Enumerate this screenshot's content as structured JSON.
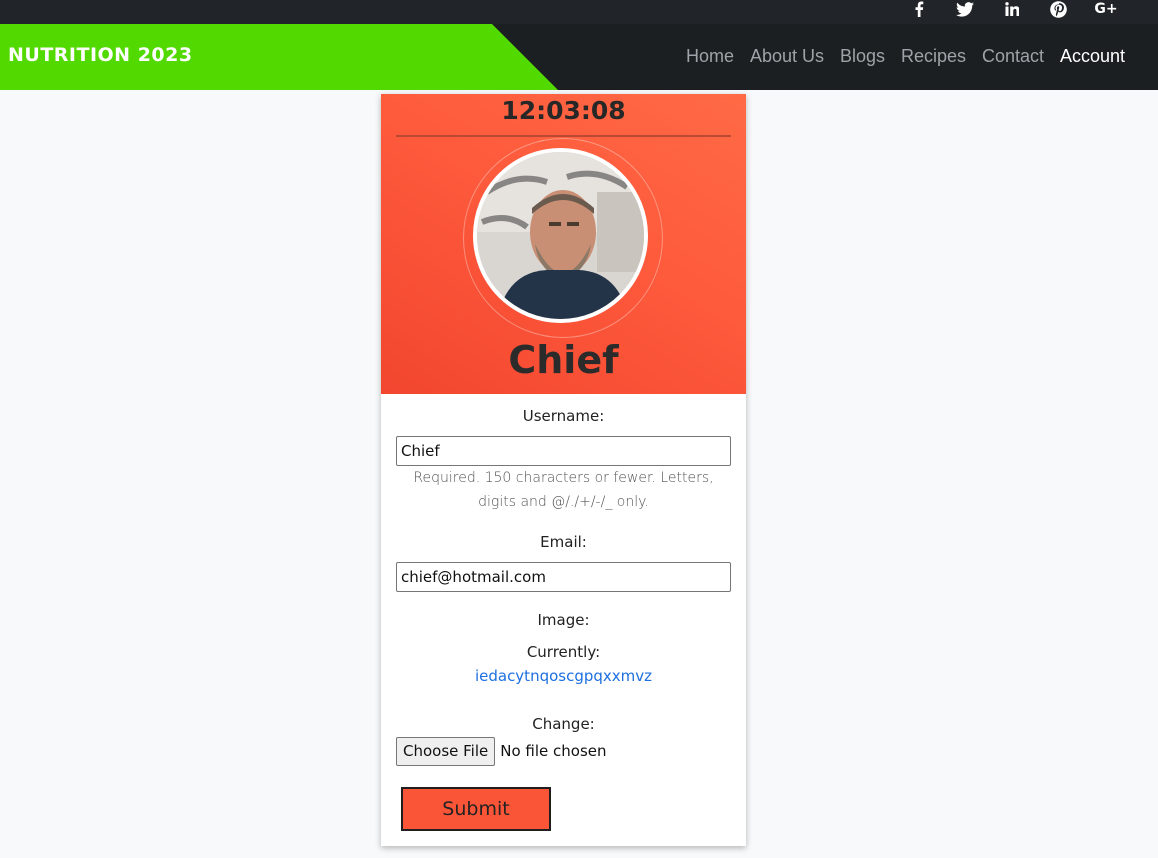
{
  "social": {
    "icons": [
      "facebook-icon",
      "twitter-icon",
      "linkedin-icon",
      "pinterest-icon",
      "google-plus-icon"
    ],
    "google_plus_label": "G+"
  },
  "navbar": {
    "brand": "NUTRITION 2023",
    "brand_color": "#52d900",
    "background": "#1c1f22",
    "links": [
      {
        "label": "Home",
        "active": false
      },
      {
        "label": "About Us",
        "active": false
      },
      {
        "label": "Blogs",
        "active": false
      },
      {
        "label": "Recipes",
        "active": false
      },
      {
        "label": "Contact",
        "active": false
      },
      {
        "label": "Account",
        "active": true
      }
    ]
  },
  "profile": {
    "clock": "12:03:08",
    "name": "Chief",
    "header_color": "#fe5a3c"
  },
  "form": {
    "username_label": "Username:",
    "username_value": "Chief",
    "username_help": "Required. 150 characters or fewer. Letters, digits and @/./+/-/_ only.",
    "email_label": "Email:",
    "email_value": "chief@hotmail.com",
    "image_label": "Image:",
    "currently_label": "Currently:",
    "current_image_link": "iedacytnqoscgpqxxmvz",
    "change_label": "Change:",
    "choose_file_label": "Choose File",
    "file_status": "No file chosen",
    "submit_label": "Submit"
  }
}
